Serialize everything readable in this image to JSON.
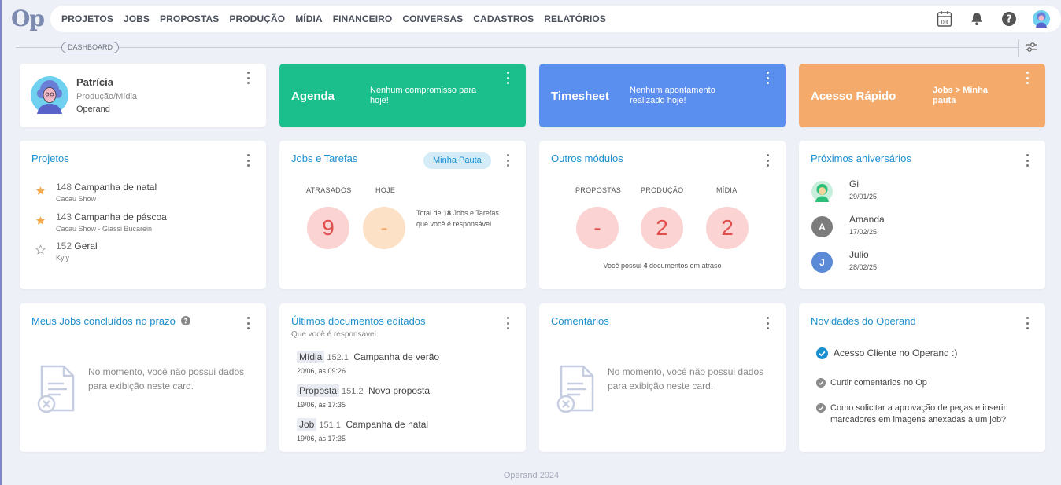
{
  "logo": "Op",
  "nav": [
    "PROJETOS",
    "JOBS",
    "PROPOSTAS",
    "PRODUÇÃO",
    "MÍDIA",
    "FINANCEIRO",
    "CONVERSAS",
    "CADASTROS",
    "RELATÓRIOS"
  ],
  "nav_icons": [
    "calendar-icon",
    "bell-icon",
    "help-icon",
    "user-avatar"
  ],
  "calendar_day": "03",
  "breadcrumb": "DASHBOARD",
  "profile": {
    "name": "Patrícia",
    "role": "Produção/Mídia",
    "org": "Operand"
  },
  "agenda": {
    "title": "Agenda",
    "message": "Nenhum compromisso para hoje!",
    "color": "#1bbf8c"
  },
  "timesheet": {
    "title": "Timesheet",
    "message": "Nenhum apontamento realizado hoje!",
    "color": "#5b8fef"
  },
  "quick_access": {
    "title": "Acesso Rápido",
    "link": "Jobs > Minha pauta",
    "color": "#f4aa6b"
  },
  "projects": {
    "title": "Projetos",
    "items": [
      {
        "num": "148",
        "name": "Campanha de natal",
        "client": "Cacau Show",
        "starred": true
      },
      {
        "num": "143",
        "name": "Campanha de páscoa",
        "client": "Cacau Show - Giassi Bucarein",
        "starred": true
      },
      {
        "num": "152",
        "name": "Geral",
        "client": "Kyly",
        "starred": false
      }
    ]
  },
  "jobs": {
    "title": "Jobs e Tarefas",
    "pill": "Minha Pauta",
    "late_label": "ATRASADOS",
    "late_value": "9",
    "today_label": "HOJE",
    "today_value": "-",
    "note_prefix": "Total de ",
    "note_count": "18",
    "note_suffix": " Jobs e Tarefas que você é responsável"
  },
  "modules": {
    "title": "Outros módulos",
    "items": [
      {
        "label": "PROPOSTAS",
        "value": "-"
      },
      {
        "label": "PRODUÇÃO",
        "value": "2"
      },
      {
        "label": "MÍDIA",
        "value": "2"
      }
    ],
    "note_prefix": "Você possui ",
    "note_count": "4",
    "note_suffix": " documentos em atraso"
  },
  "birthdays": {
    "title": "Próximos aniversários",
    "items": [
      {
        "name": "Gi",
        "date": "29/01/25",
        "initial": "",
        "color": "#2bbf7a"
      },
      {
        "name": "Amanda",
        "date": "17/02/25",
        "initial": "A",
        "color": "#7c7c7c"
      },
      {
        "name": "Julio",
        "date": "28/02/25",
        "initial": "J",
        "color": "#5b8bd6"
      }
    ]
  },
  "my_jobs": {
    "title": "Meus Jobs concluídos no prazo",
    "empty": "No momento, você não possui dados para exibição neste card."
  },
  "recent_docs": {
    "title": "Últimos documentos editados",
    "subtitle": "Que você é responsável",
    "items": [
      {
        "type": "Mídia",
        "num": "152.1",
        "name": "Campanha de verão",
        "date": "20/06, às 09:26"
      },
      {
        "type": "Proposta",
        "num": "151.2",
        "name": "Nova proposta",
        "date": "19/06, às 17:35"
      },
      {
        "type": "Job",
        "num": "151.1",
        "name": "Campanha de natal",
        "date": "19/06, às 17:35"
      }
    ]
  },
  "comments": {
    "title": "Comentários",
    "empty": "No momento, você não possui dados para exibição neste card."
  },
  "news": {
    "title": "Novidades do Operand",
    "items": [
      {
        "text": "Acesso Cliente no Operand :)",
        "highlight": true
      },
      {
        "text": "Curtir comentários no Op",
        "highlight": false
      },
      {
        "text": "Como solicitar a aprovação de peças e inserir marcadores em imagens anexadas a um job?",
        "highlight": false
      }
    ]
  },
  "footer": "Operand 2024"
}
